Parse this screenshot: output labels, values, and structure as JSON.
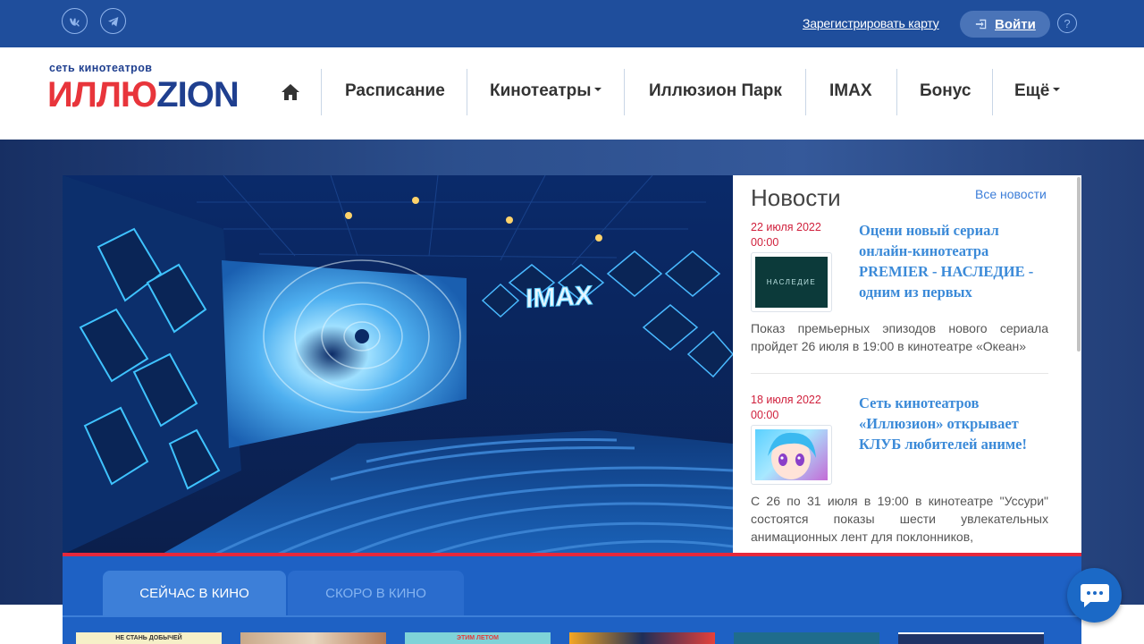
{
  "topbar": {
    "social": [
      "vk-icon",
      "telegram-icon"
    ],
    "register_card": "Зарегистрировать карту",
    "login": "Войти",
    "help": "?"
  },
  "logo": {
    "tagline": "сеть кинотеатров",
    "part1": "ИЛЛЮ",
    "part2": "Z",
    "part3": "I",
    "part4": "ON"
  },
  "nav": {
    "items": [
      {
        "label": "Расписание"
      },
      {
        "label": "Кинотеатры"
      },
      {
        "label": "Иллюзион Парк"
      },
      {
        "label": "IMAX"
      },
      {
        "label": "Бонус"
      },
      {
        "label": "Ещё"
      }
    ]
  },
  "hero": {
    "imax_label": "IMAX"
  },
  "news": {
    "title": "Новости",
    "all_link": "Все новости",
    "items": [
      {
        "date": "22 июля 2022 00:00",
        "headline": "Оцени новый сериал онлайн-кинотеатра PREMIER - НАСЛЕДИЕ - одним из первых",
        "thumb_text": "НАСЛЕДИЕ",
        "body": "Показ премьерных эпизодов нового сериала пройдет 26 июля в 19:00 в кинотеатре «Океан»"
      },
      {
        "date": "18 июля 2022 00:00",
        "headline": "Сеть кинотеатров «Иллюзион» открывает КЛУБ любителей аниме!",
        "body": "С 26 по 31 июля в 19:00 в кинотеатре \"Уссури\" состоятся показы шести увлекательных анимационных лент для поклонников,"
      }
    ]
  },
  "tabs": {
    "now": "СЕЙЧАС В КИНО",
    "soon": "СКОРО В КИНО"
  },
  "posters": [
    {
      "text": "НЕ СТАНЬ ДОБЫЧЕЙ"
    },
    {
      "text": ""
    },
    {
      "text": "ЭТИМ ЛЕТОМ"
    },
    {
      "text": ""
    },
    {
      "text": ""
    },
    {
      "text": ""
    }
  ],
  "colors": {
    "topbar": "#1f4e9c",
    "accent_red": "#e5283c",
    "tabs_band": "#1e61c4",
    "link_blue": "#3b8ad8"
  }
}
